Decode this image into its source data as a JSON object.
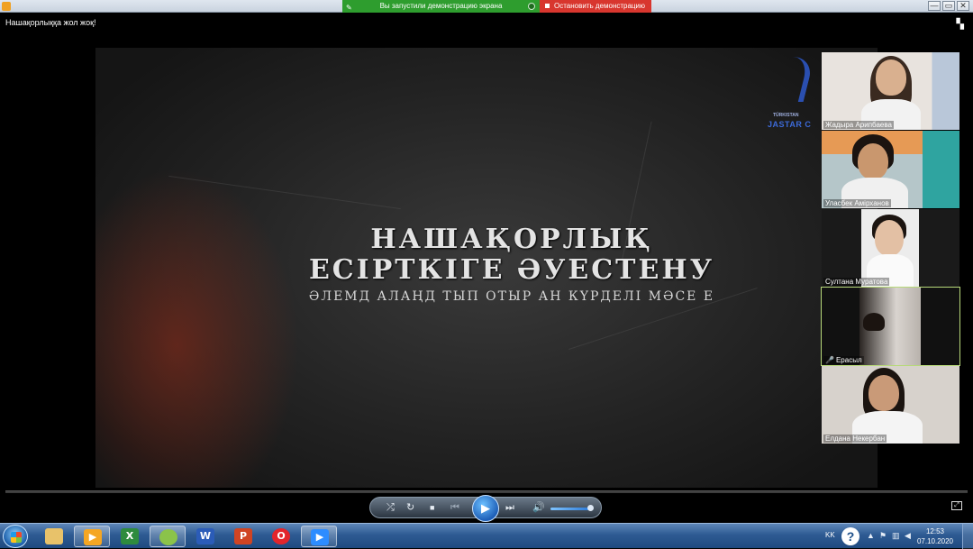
{
  "window": {
    "controls": {
      "minimize": "—",
      "maximize": "▭",
      "close": "✕"
    }
  },
  "share_banner": {
    "status_text": "Вы запустили демонстрацию экрана",
    "stop_label": "Остановить демонстрацию",
    "status_color": "#2e9d2e",
    "stop_color": "#d8362e"
  },
  "meeting_title": "Нашақорлыққа жол жоқ!",
  "slide": {
    "line1": "НАШАҚОРЛЫҚ",
    "line2": "ЕСІРТКІГЕ ӘУЕСТЕНУ",
    "subtitle": "ӘЛЕМД АЛАҢД ТЫП ОТЫР АН КҮРДЕЛІ МӘСЕ Е",
    "logo_small": "TÜRKISTAN",
    "logo_big": "JASTAR C"
  },
  "participants": [
    {
      "name": "Жадыра Арипбаева",
      "muted": false
    },
    {
      "name": "Уласбек Амірханов",
      "muted": false
    },
    {
      "name": "Султана Муратова",
      "muted": false
    },
    {
      "name": "Ерасыл",
      "muted": true
    },
    {
      "name": "Елдана Некербан",
      "muted": false
    }
  ],
  "player": {
    "shuffle": "⤮",
    "repeat": "↻",
    "stop": "■",
    "prev": "⏮",
    "play": "▶",
    "next": "⏭",
    "volume": "🔊",
    "volume_level": 0.9,
    "progress": 0.0
  },
  "taskbar": {
    "items": [
      {
        "name": "explorer",
        "glyph": "",
        "color": "#e8c26a"
      },
      {
        "name": "media-player",
        "glyph": "▶",
        "color": "#f5a623"
      },
      {
        "name": "excel",
        "glyph": "X",
        "color": "#2e8b3e"
      },
      {
        "name": "app-green",
        "glyph": "",
        "color": "#8bc34a"
      },
      {
        "name": "word",
        "glyph": "W",
        "color": "#2b5cb8"
      },
      {
        "name": "powerpoint",
        "glyph": "P",
        "color": "#d04423"
      },
      {
        "name": "opera",
        "glyph": "O",
        "color": "#e3252c"
      },
      {
        "name": "zoom",
        "glyph": "▶",
        "color": "#2d8cff"
      }
    ],
    "lang": "KK",
    "help": "?",
    "time": "12:53",
    "date": "07.10.2020"
  }
}
